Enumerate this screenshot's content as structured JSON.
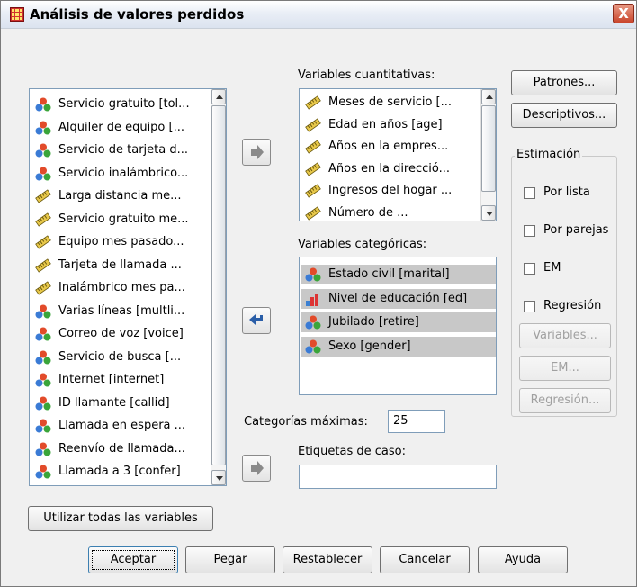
{
  "window": {
    "title": "Análisis de valores perdidos",
    "close_label": "X"
  },
  "source_list": {
    "items": [
      {
        "label": "Servicio gratuito [tol...",
        "icon": "nominal-icon"
      },
      {
        "label": "Alquiler de equipo [...",
        "icon": "nominal-icon"
      },
      {
        "label": "Servicio de tarjeta d...",
        "icon": "nominal-icon"
      },
      {
        "label": "Servicio inalámbrico...",
        "icon": "nominal-icon"
      },
      {
        "label": "Larga distancia me...",
        "icon": "scale-icon"
      },
      {
        "label": "Servicio gratuito me...",
        "icon": "scale-icon"
      },
      {
        "label": "Equipo mes pasado...",
        "icon": "scale-icon"
      },
      {
        "label": "Tarjeta de llamada ...",
        "icon": "scale-icon"
      },
      {
        "label": "Inalámbrico mes pa...",
        "icon": "scale-icon"
      },
      {
        "label": "Varias líneas [multli...",
        "icon": "nominal-icon"
      },
      {
        "label": "Correo de voz [voice]",
        "icon": "nominal-icon"
      },
      {
        "label": "Servicio de busca [...",
        "icon": "nominal-icon"
      },
      {
        "label": "Internet [internet]",
        "icon": "nominal-icon"
      },
      {
        "label": "ID llamante [callid]",
        "icon": "nominal-icon"
      },
      {
        "label": "Llamada en espera ...",
        "icon": "nominal-icon"
      },
      {
        "label": "Reenvío de llamada...",
        "icon": "nominal-icon"
      },
      {
        "label": "Llamada a 3 [confer]",
        "icon": "nominal-icon"
      }
    ]
  },
  "quantitative": {
    "label": "Variables cuantitativas:",
    "items": [
      {
        "label": "Meses de servicio [...",
        "icon": "scale-icon"
      },
      {
        "label": "Edad en años [age]",
        "icon": "scale-icon"
      },
      {
        "label": "Años en la empres...",
        "icon": "scale-icon"
      },
      {
        "label": "Años en la direcció...",
        "icon": "scale-icon"
      },
      {
        "label": "Ingresos del hogar ...",
        "icon": "scale-icon"
      },
      {
        "label": "Número de ...",
        "icon": "scale-icon"
      }
    ]
  },
  "categorical": {
    "label": "Variables categóricas:",
    "items": [
      {
        "label": "Estado civil [marital]",
        "icon": "nominal-icon"
      },
      {
        "label": "Nivel de educación [ed]",
        "icon": "ordinal-icon"
      },
      {
        "label": "Jubilado [retire]",
        "icon": "nominal-icon"
      },
      {
        "label": "Sexo [gender]",
        "icon": "nominal-icon"
      }
    ]
  },
  "max_categories": {
    "label": "Categorías máximas:",
    "value": "25"
  },
  "case_labels": {
    "label": "Etiquetas de caso:",
    "value": ""
  },
  "side_buttons": {
    "patterns": "Patrones...",
    "descriptives": "Descriptivos..."
  },
  "estimation": {
    "title": "Estimación",
    "checkboxes": [
      "Por lista",
      "Por parejas",
      "EM",
      "Regresión"
    ],
    "buttons": [
      "Variables...",
      "EM...",
      "Regresión..."
    ]
  },
  "use_all_button": "Utilizar todas las variables",
  "footer": {
    "ok": "Aceptar",
    "paste": "Pegar",
    "reset": "Restablecer",
    "cancel": "Cancelar",
    "help": "Ayuda"
  },
  "colors": {
    "selection": "#c8c8c8",
    "title_bar": "#dbe3ef",
    "arrow_blue": "#2a5ea8"
  }
}
